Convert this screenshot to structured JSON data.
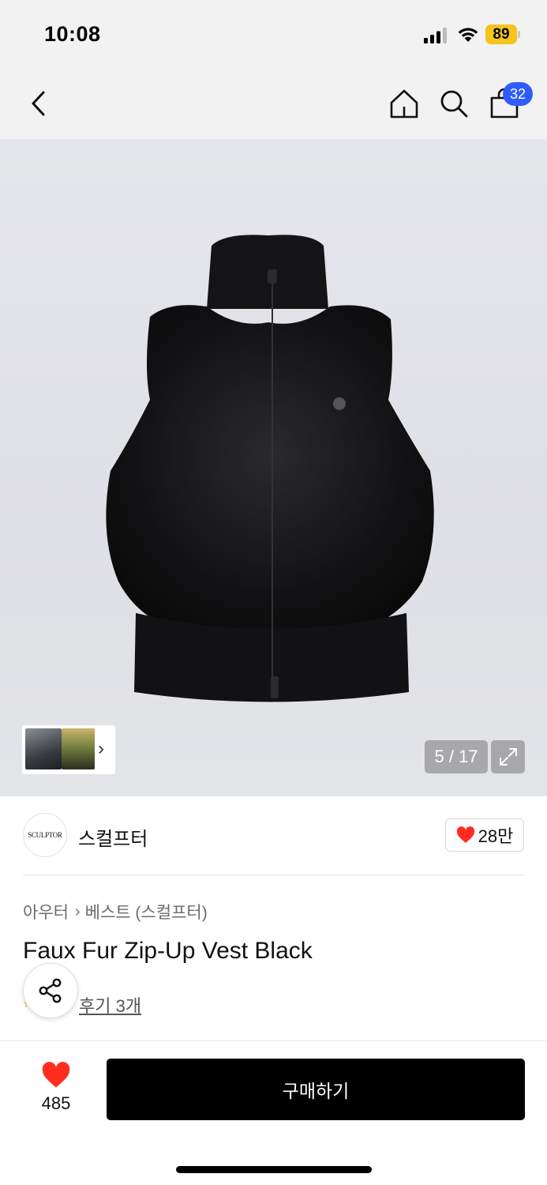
{
  "status_bar": {
    "time": "10:08",
    "battery_level": "89",
    "battery_color": "#f5c518"
  },
  "nav": {
    "back_icon": "chevron-left-icon",
    "home_icon": "home-icon",
    "search_icon": "search-icon",
    "cart_icon": "shopping-bag-icon",
    "cart_count": "32",
    "badge_color": "#2f5cff"
  },
  "gallery": {
    "counter": "5 / 17",
    "current_index": 5,
    "total": 17,
    "expand_icon": "expand-icon",
    "thumbnail_chevron": "›"
  },
  "brand": {
    "logo_text": "SCULPTOR",
    "name": "스컬프터",
    "like_count": "28만",
    "heart_color": "#ff2d20"
  },
  "product": {
    "breadcrumb": [
      "아우터",
      "베스트 (스컬프터)"
    ],
    "title": "Faux Fur Zip-Up Vest Black",
    "review_link": "후기 3개"
  },
  "footer": {
    "wish_count": "485",
    "buy_label": "구매하기",
    "buy_color": "#000000"
  }
}
